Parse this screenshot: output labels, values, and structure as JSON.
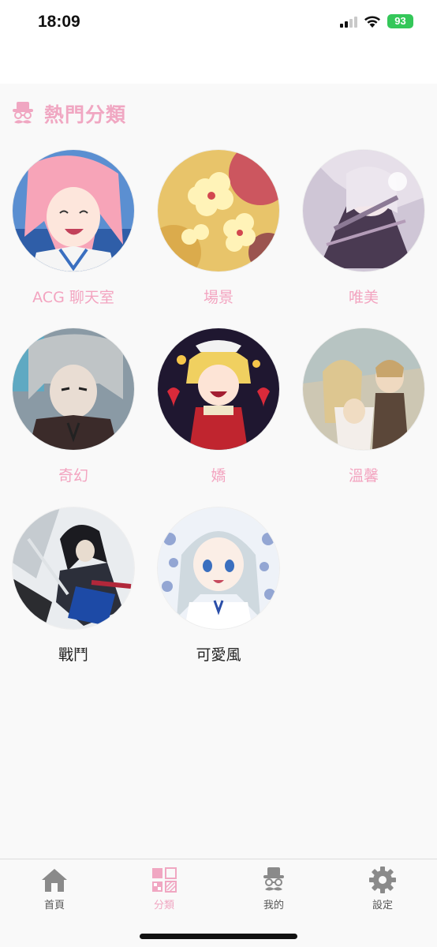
{
  "status_bar": {
    "time": "18:09",
    "battery": "93"
  },
  "section": {
    "title": "熱門分類",
    "icon": "gentleman-icon"
  },
  "categories": [
    {
      "label": "ACG 聊天室",
      "image": "pink-hair-anime-girl"
    },
    {
      "label": "場景",
      "image": "cherry-blossom-scene"
    },
    {
      "label": "唯美",
      "image": "aesthetic-anime-girl"
    },
    {
      "label": "奇幻",
      "image": "fantasy-silver-hair-boy"
    },
    {
      "label": "嬌",
      "image": "blonde-girl-hearts"
    },
    {
      "label": "溫馨",
      "image": "warm-family-scene"
    },
    {
      "label": "戰鬥",
      "image": "battle-swordsman"
    },
    {
      "label": "可愛風",
      "image": "cute-blue-eyed-girl"
    }
  ],
  "tab_bar": {
    "items": [
      {
        "label": "首頁",
        "icon": "home-icon"
      },
      {
        "label": "分類",
        "icon": "category-grid-icon"
      },
      {
        "label": "我的",
        "icon": "profile-hat-icon"
      },
      {
        "label": "設定",
        "icon": "gear-icon"
      }
    ],
    "active": "分類"
  },
  "colors": {
    "accent": "#f0a7c2",
    "tab_inactive": "#777777"
  }
}
